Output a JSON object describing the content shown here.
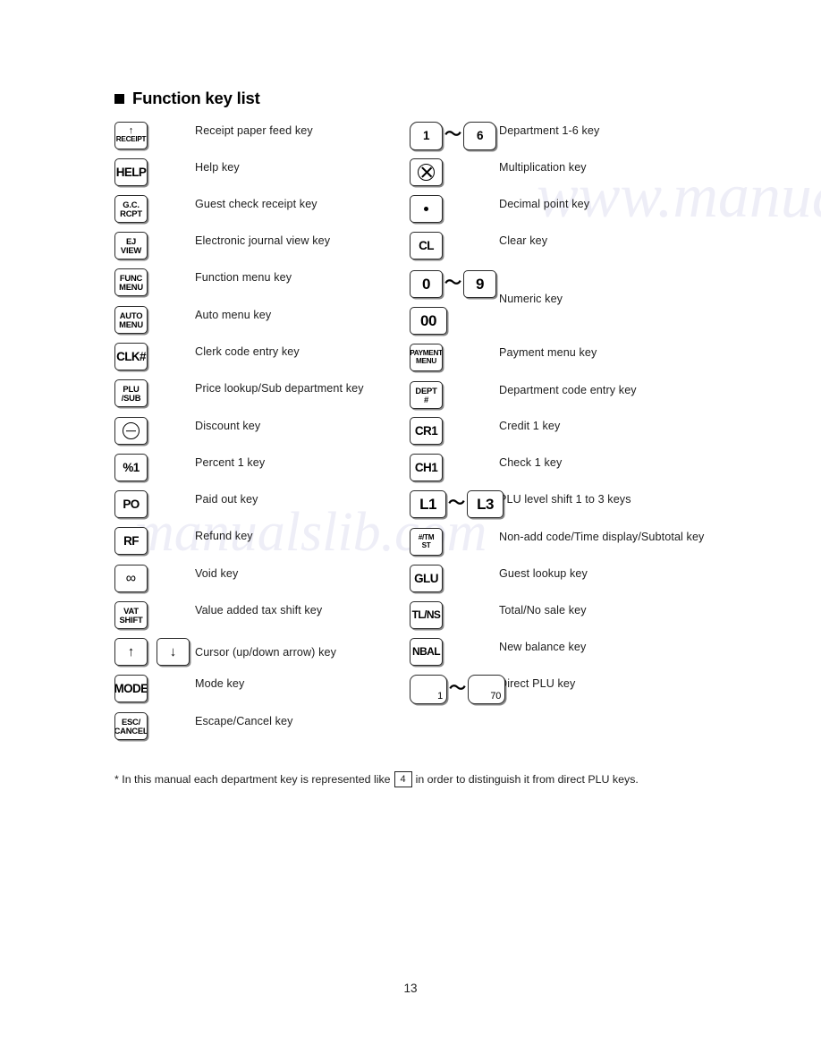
{
  "page": {
    "title": "Function key list",
    "bullet_icon": "filled-square-icon",
    "page_number": "13"
  },
  "footnote": {
    "prefix": "* In this manual each department key is represented like",
    "example_key": "4",
    "suffix": "in order to distinguish it from direct PLU keys."
  },
  "watermark": {
    "text1": "www.manualslib.com",
    "text2": "manualslib.com"
  },
  "left_column": [
    {
      "key": {
        "type": "receipt",
        "icon": "up-arrow-icon",
        "lines": [
          "RECEIPT"
        ]
      },
      "label": "Receipt paper feed key"
    },
    {
      "key": {
        "type": "text1",
        "lines": [
          "HELP"
        ]
      },
      "label": "Help key"
    },
    {
      "key": {
        "type": "text2",
        "lines": [
          "G.C.",
          "RCPT"
        ]
      },
      "label": "Guest check receipt key"
    },
    {
      "key": {
        "type": "text2",
        "lines": [
          "EJ",
          "VIEW"
        ]
      },
      "label": "Electronic journal view key"
    },
    {
      "key": {
        "type": "text2",
        "lines": [
          "FUNC",
          "MENU"
        ]
      },
      "label": "Function menu key"
    },
    {
      "key": {
        "type": "text2",
        "lines": [
          "AUTO",
          "MENU"
        ]
      },
      "label": "Auto menu key"
    },
    {
      "key": {
        "type": "text1",
        "lines": [
          "CLK#"
        ]
      },
      "label": "Clerk code entry key"
    },
    {
      "key": {
        "type": "text2",
        "lines": [
          "PLU",
          "/SUB"
        ]
      },
      "label": "Price lookup/Sub department key"
    },
    {
      "key": {
        "type": "symbol",
        "symbol": "circle-minus-icon"
      },
      "label": "Discount key"
    },
    {
      "key": {
        "type": "text1",
        "lines": [
          "%1"
        ]
      },
      "label": "Percent 1 key"
    },
    {
      "key": {
        "type": "text1",
        "lines": [
          "PO"
        ]
      },
      "label": "Paid out key"
    },
    {
      "key": {
        "type": "text1",
        "lines": [
          "RF"
        ]
      },
      "label": "Refund key"
    },
    {
      "key": {
        "type": "symbol",
        "symbol": "void-loop-icon",
        "glyph": "∞"
      },
      "label": "Void key"
    },
    {
      "key": {
        "type": "text2",
        "lines": [
          "VAT",
          "SHIFT"
        ]
      },
      "label": "Value added tax shift key"
    },
    {
      "key": {
        "type": "pair-arrows",
        "glyph_up": "↑",
        "glyph_down": "↓"
      },
      "label": "Cursor (up/down arrow) key"
    },
    {
      "key": {
        "type": "text1",
        "lines": [
          "MODE"
        ]
      },
      "label": "Mode key"
    },
    {
      "key": {
        "type": "text2",
        "lines": [
          "ESC/",
          "CANCEL"
        ]
      },
      "label": "Escape/Cancel key"
    }
  ],
  "right_column": [
    {
      "key": {
        "type": "range-dept",
        "from": "1",
        "to": "6",
        "tilde": "～"
      },
      "label": "Department 1-6 key"
    },
    {
      "key": {
        "type": "symbol",
        "symbol": "circle-times-icon"
      },
      "label": "Multiplication key"
    },
    {
      "key": {
        "type": "symbol",
        "symbol": "dot-icon"
      },
      "label": "Decimal point key"
    },
    {
      "key": {
        "type": "text1",
        "lines": [
          "CL"
        ]
      },
      "label": "Clear key"
    },
    {
      "key": {
        "type": "range-numeric",
        "from": "0",
        "to": "9",
        "extra": "00",
        "tilde": "～"
      },
      "label": "Numeric key"
    },
    {
      "key": {
        "type": "text2-small",
        "lines": [
          "PAYMENT",
          "MENU"
        ]
      },
      "label": "Payment menu key"
    },
    {
      "key": {
        "type": "text2",
        "lines": [
          "DEPT",
          "#"
        ]
      },
      "label": "Department code entry key"
    },
    {
      "key": {
        "type": "text1",
        "lines": [
          "CR1"
        ]
      },
      "label": "Credit 1 key"
    },
    {
      "key": {
        "type": "text1",
        "lines": [
          "CH1"
        ]
      },
      "label": "Check 1 key"
    },
    {
      "key": {
        "type": "range-level",
        "from": "L1",
        "to": "L3",
        "tilde": "～"
      },
      "label": "PLU level shift 1 to 3 keys"
    },
    {
      "key": {
        "type": "text2-small",
        "lines": [
          "#/TM",
          "ST"
        ]
      },
      "label": "Non-add code/Time display/Subtotal key"
    },
    {
      "key": {
        "type": "text1",
        "lines": [
          "GLU"
        ]
      },
      "label": "Guest lookup key"
    },
    {
      "key": {
        "type": "text1-narrow",
        "lines": [
          "TL/NS"
        ]
      },
      "label": "Total/No sale key"
    },
    {
      "key": {
        "type": "text1-narrow",
        "lines": [
          "NBAL"
        ]
      },
      "label": "New balance key"
    },
    {
      "key": {
        "type": "range-plu",
        "from": "1",
        "to": "70",
        "tilde": "～"
      },
      "label": "Direct PLU key"
    }
  ]
}
